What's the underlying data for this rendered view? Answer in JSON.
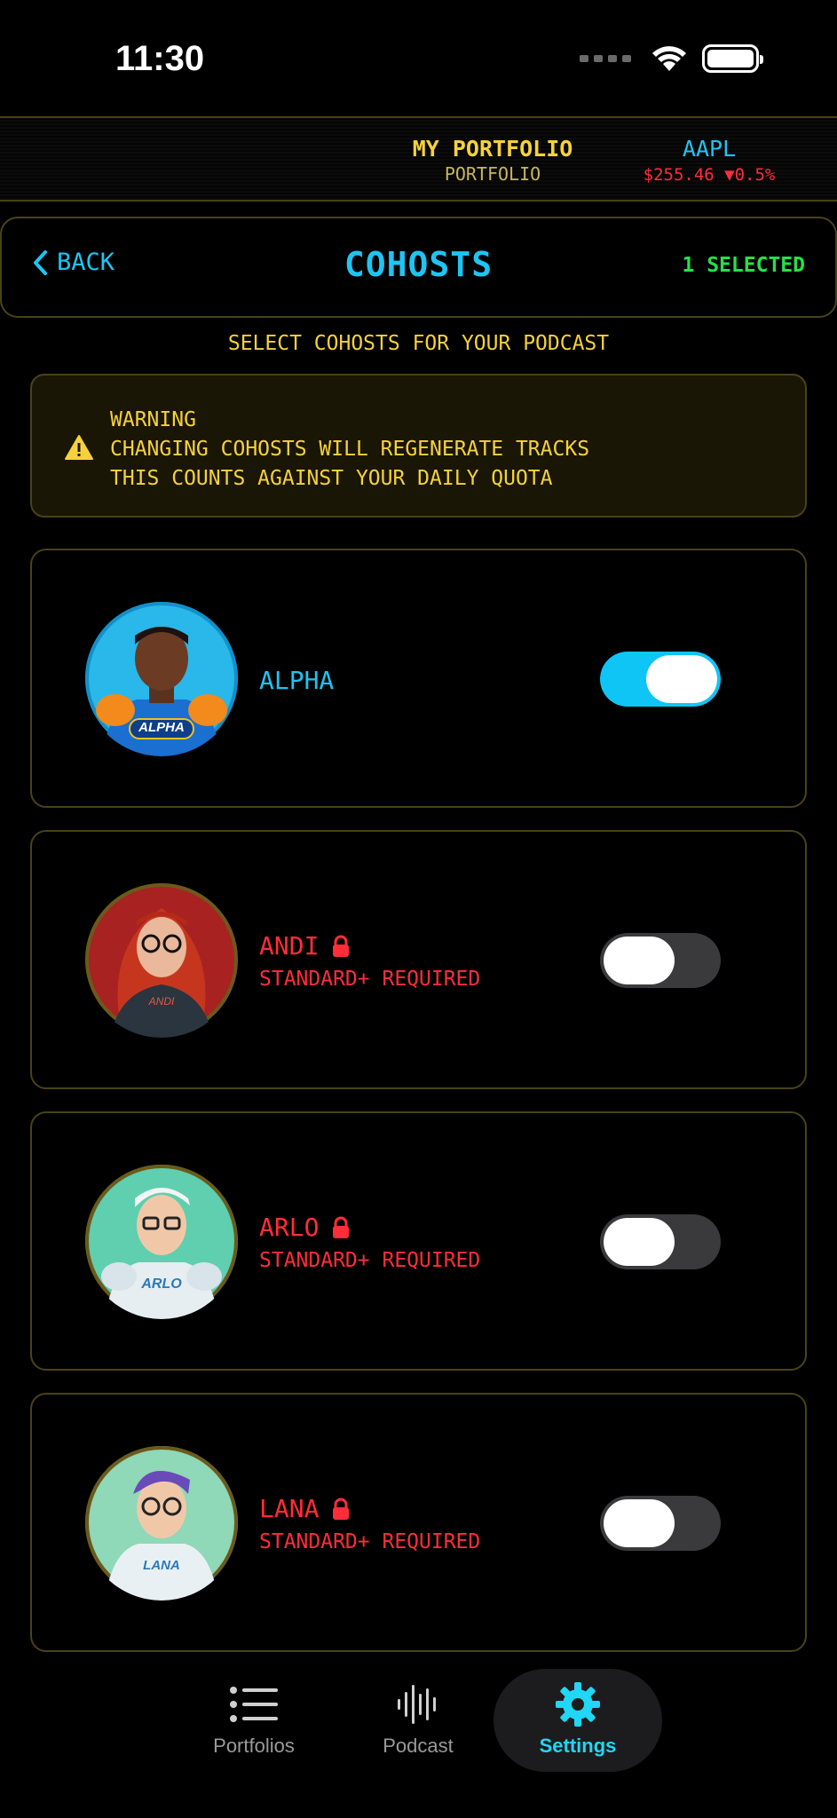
{
  "status": {
    "time": "11:30"
  },
  "ticker": {
    "portfolio_title": "MY PORTFOLIO",
    "portfolio_sub": "PORTFOLIO",
    "symbol": "AAPL",
    "price": "$255.46 ▼0.5%"
  },
  "header": {
    "back_label": "BACK",
    "title": "COHOSTS",
    "selected": "1 SELECTED"
  },
  "subtitle": "SELECT COHOSTS FOR YOUR PODCAST",
  "warning": {
    "title": "WARNING",
    "line1": "CHANGING COHOSTS WILL REGENERATE TRACKS",
    "line2": "THIS COUNTS AGAINST YOUR DAILY QUOTA"
  },
  "cohosts": [
    {
      "name": "ALPHA",
      "badge": "ALPHA",
      "requirement": "",
      "locked": false,
      "enabled": true
    },
    {
      "name": "ANDI",
      "badge": "ANDI",
      "requirement": "STANDARD+ REQUIRED",
      "locked": true,
      "enabled": false
    },
    {
      "name": "ARLO",
      "badge": "ARLO",
      "requirement": "STANDARD+ REQUIRED",
      "locked": true,
      "enabled": false
    },
    {
      "name": "LANA",
      "badge": "LANA",
      "requirement": "STANDARD+ REQUIRED",
      "locked": true,
      "enabled": false
    }
  ],
  "tabs": [
    {
      "label": "Portfolios",
      "icon": "list-icon"
    },
    {
      "label": "Podcast",
      "icon": "waveform-icon"
    },
    {
      "label": "Settings",
      "icon": "gear-icon",
      "active": true
    }
  ],
  "colors": {
    "accent": "#1fc4f2",
    "warning": "#f5d23a",
    "locked": "#ff2d3a",
    "selected": "#26e04a",
    "border": "#4a4218"
  }
}
